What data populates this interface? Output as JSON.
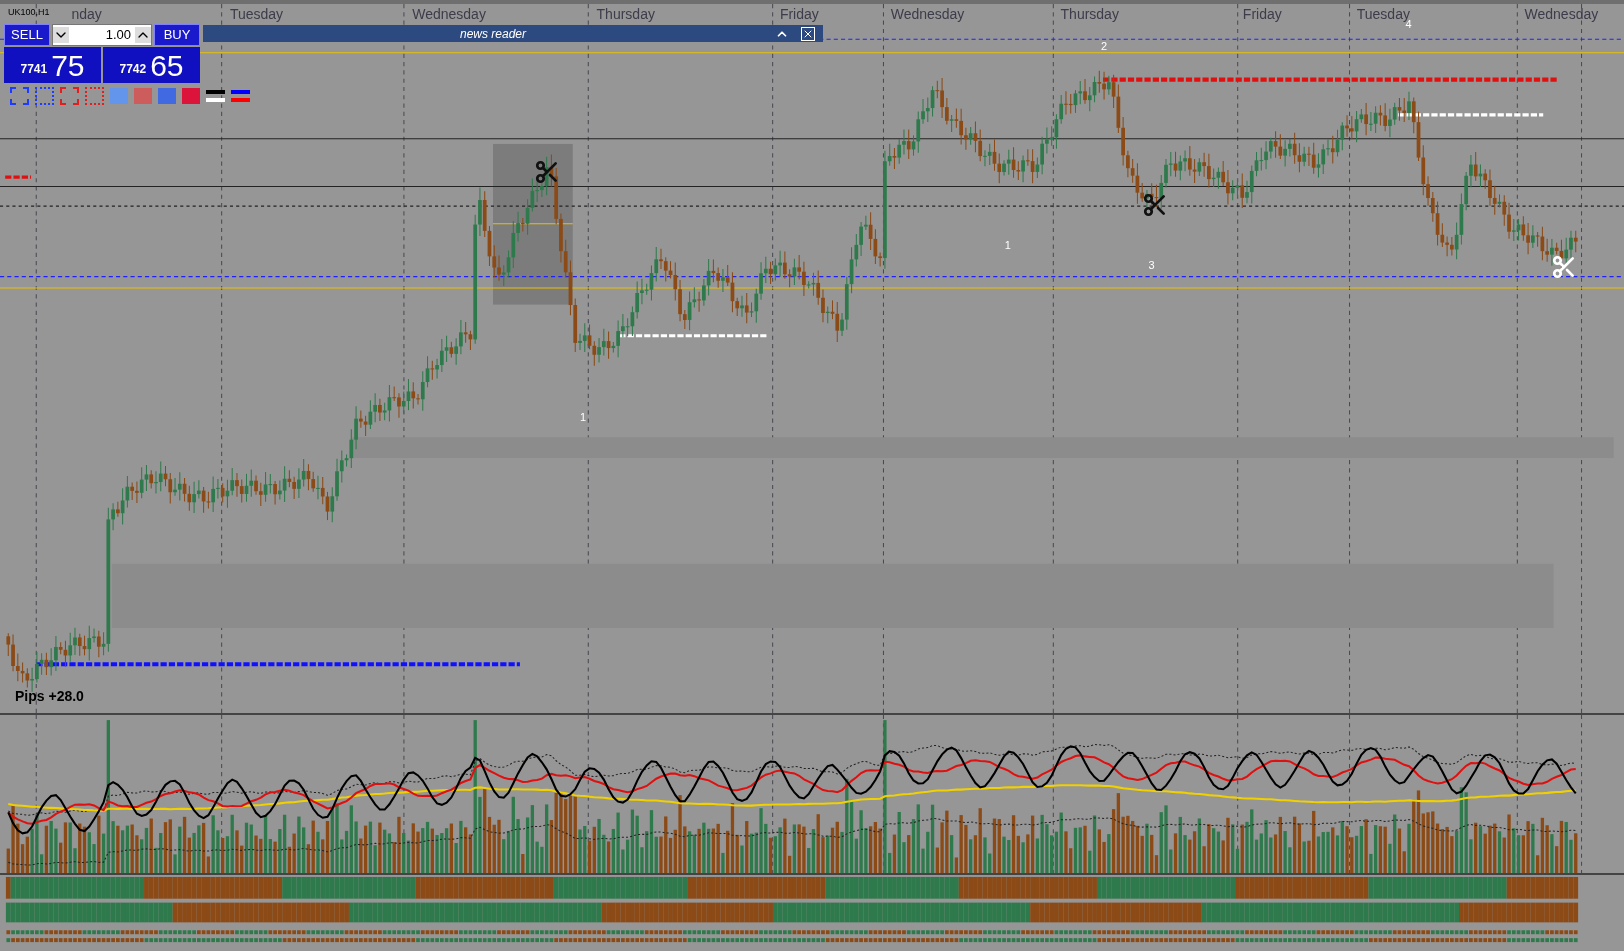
{
  "symbol": "UK100,H1",
  "trade_panel": {
    "sell": "SELL",
    "buy": "BUY",
    "lot": "1.00",
    "bid_big": "7741",
    "bid_small": "75",
    "ask_big": "7742",
    "ask_small": "65"
  },
  "drawing_tools": [
    {
      "kind": "outline",
      "color": "#1e3cff"
    },
    {
      "kind": "outline",
      "color": "#1e3cff"
    },
    {
      "kind": "outline",
      "color": "#e02020"
    },
    {
      "kind": "outline",
      "color": "#e02020"
    },
    {
      "kind": "fill",
      "color": "#6495ed"
    },
    {
      "kind": "fill",
      "color": "#cd5c5c"
    },
    {
      "kind": "fill",
      "color": "#4169e1"
    },
    {
      "kind": "fill",
      "color": "#dc143c"
    },
    {
      "kind": "lines",
      "color": "#000000"
    },
    {
      "kind": "lines",
      "color": "#0000ff"
    }
  ],
  "news_reader": {
    "title": "news reader"
  },
  "day_labels": [
    "nday",
    "Tuesday",
    "Wednesday",
    "Thursday",
    "Friday",
    "Wednesday",
    "Thursday",
    "Friday",
    "Tuesday",
    "Wednesday"
  ],
  "markers": [
    "1",
    "1",
    "3",
    "2",
    "4"
  ],
  "pips": "Pips +28.0"
}
